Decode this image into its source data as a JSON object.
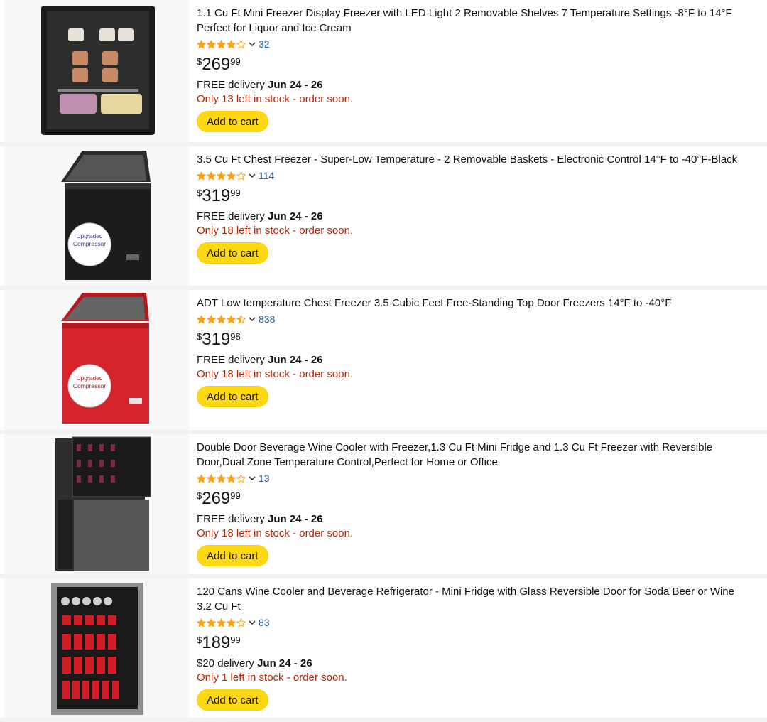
{
  "colors": {
    "star": "#f4a31a",
    "link": "#2162a1",
    "stock": "#b12704",
    "button": "#ffd814"
  },
  "products": [
    {
      "title": "1.1 Cu Ft Mini Freezer Display Freezer with LED Light 2 Removable Shelves 7 Temperature Settings -8°F to 14°F Perfect for Liquor and Ice Cream",
      "stars": 4.0,
      "rating_count": "32",
      "price_symbol": "$",
      "price_whole": "269",
      "price_fraction": "99",
      "delivery_prefix": "FREE delivery",
      "delivery_date": "Jun 24 - 26",
      "stock": "Only 13 left in stock - order soon.",
      "button": "Add to cart",
      "image": "mini-display-freezer-icon"
    },
    {
      "title": "3.5 Cu Ft Chest Freezer - Super-Low Temperature - 2 Removable Baskets - Electronic Control 14°F to -40°F-Black",
      "stars": 4.0,
      "rating_count": "114",
      "price_symbol": "$",
      "price_whole": "319",
      "price_fraction": "99",
      "delivery_prefix": "FREE delivery",
      "delivery_date": "Jun 24 - 26",
      "stock": "Only 18 left in stock - order soon.",
      "button": "Add to cart",
      "image": "black-chest-freezer-icon",
      "badge_text": "Upgraded Compressor"
    },
    {
      "title": "ADT Low temperature Chest Freezer 3.5 Cubic Feet Free-Standing Top Door Freezers 14°F to -40°F",
      "stars": 4.5,
      "rating_count": "838",
      "price_symbol": "$",
      "price_whole": "319",
      "price_fraction": "98",
      "delivery_prefix": "FREE delivery",
      "delivery_date": "Jun 24 - 26",
      "stock": "Only 18 left in stock - order soon.",
      "button": "Add to cart",
      "image": "red-chest-freezer-icon",
      "badge_text": "Upgraded Compressor"
    },
    {
      "title": "Double Door Beverage Wine Cooler with Freezer,1.3 Cu Ft Mini Fridge and 1.3 Cu Ft Freezer with Reversible Door,Dual Zone Temperature Control,Perfect for Home or Office",
      "stars": 4.0,
      "rating_count": "13",
      "price_symbol": "$",
      "price_whole": "269",
      "price_fraction": "99",
      "delivery_prefix": "FREE delivery",
      "delivery_date": "Jun 24 - 26",
      "stock": "Only 18 left in stock - order soon.",
      "button": "Add to cart",
      "image": "double-door-wine-cooler-icon"
    },
    {
      "title": "120 Cans Wine Cooler and Beverage Refrigerator - Mini Fridge with Glass Reversible Door for Soda Beer or Wine 3.2 Cu Ft",
      "stars": 4.0,
      "rating_count": "83",
      "price_symbol": "$",
      "price_whole": "189",
      "price_fraction": "99",
      "delivery_prefix": "$20 delivery",
      "delivery_date": "Jun 24 - 26",
      "stock": "Only 1 left in stock - order soon.",
      "button": "Add to cart",
      "image": "beverage-refrigerator-icon"
    }
  ]
}
